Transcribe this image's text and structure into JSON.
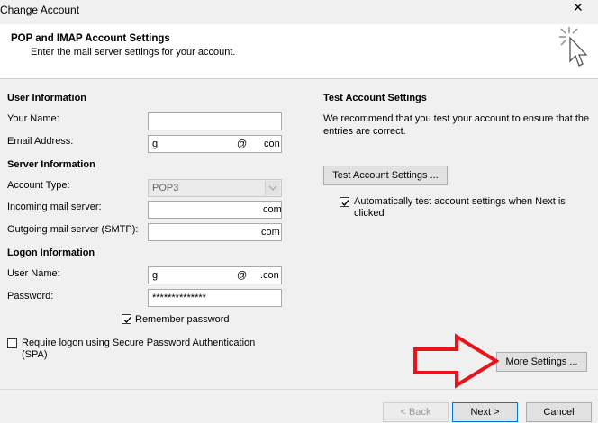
{
  "window": {
    "title": "Change Account",
    "close_glyph": "✕"
  },
  "header": {
    "title": "POP and IMAP Account Settings",
    "subtitle": "Enter the mail server settings for your account.",
    "icon": "cursor-sparkle-icon"
  },
  "user_info": {
    "heading": "User Information",
    "name_label": "Your Name:",
    "name_value": "",
    "email_label": "Email Address:",
    "email_prefix": "g",
    "email_at": "@",
    "email_suffix": "con"
  },
  "server_info": {
    "heading": "Server Information",
    "account_type_label": "Account Type:",
    "account_type_value": "POP3",
    "incoming_label": "Incoming mail server:",
    "incoming_value": "com",
    "outgoing_label": "Outgoing mail server (SMTP):",
    "outgoing_value": "com"
  },
  "logon_info": {
    "heading": "Logon Information",
    "username_label": "User Name:",
    "username_prefix": "g",
    "username_at": "@",
    "username_suffix": ".con",
    "password_label": "Password:",
    "password_value": "**************",
    "remember_label": "Remember password",
    "remember_checked": true,
    "spa_label": "Require logon using Secure Password Authentication (SPA)",
    "spa_checked": false
  },
  "test_settings": {
    "heading": "Test Account Settings",
    "description": "We recommend that you test your account to ensure that the entries are correct.",
    "test_button": "Test Account Settings ...",
    "auto_test_label": "Automatically test account settings when Next is clicked",
    "auto_test_checked": true
  },
  "buttons": {
    "more_settings": "More Settings ...",
    "back": "< Back",
    "next": "Next >",
    "cancel": "Cancel"
  },
  "annotation": {
    "arrow_color": "#e8141c"
  }
}
